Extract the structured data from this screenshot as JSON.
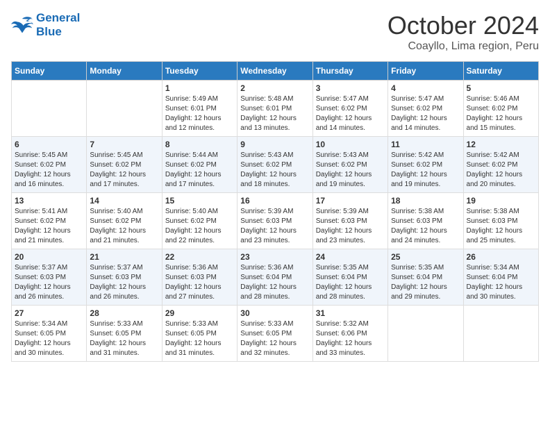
{
  "logo": {
    "line1": "General",
    "line2": "Blue"
  },
  "title": "October 2024",
  "location": "Coayllo, Lima region, Peru",
  "weekdays": [
    "Sunday",
    "Monday",
    "Tuesday",
    "Wednesday",
    "Thursday",
    "Friday",
    "Saturday"
  ],
  "weeks": [
    [
      {
        "day": "",
        "sunrise": "",
        "sunset": "",
        "daylight": ""
      },
      {
        "day": "",
        "sunrise": "",
        "sunset": "",
        "daylight": ""
      },
      {
        "day": "1",
        "sunrise": "Sunrise: 5:49 AM",
        "sunset": "Sunset: 6:01 PM",
        "daylight": "Daylight: 12 hours and 12 minutes."
      },
      {
        "day": "2",
        "sunrise": "Sunrise: 5:48 AM",
        "sunset": "Sunset: 6:01 PM",
        "daylight": "Daylight: 12 hours and 13 minutes."
      },
      {
        "day": "3",
        "sunrise": "Sunrise: 5:47 AM",
        "sunset": "Sunset: 6:02 PM",
        "daylight": "Daylight: 12 hours and 14 minutes."
      },
      {
        "day": "4",
        "sunrise": "Sunrise: 5:47 AM",
        "sunset": "Sunset: 6:02 PM",
        "daylight": "Daylight: 12 hours and 14 minutes."
      },
      {
        "day": "5",
        "sunrise": "Sunrise: 5:46 AM",
        "sunset": "Sunset: 6:02 PM",
        "daylight": "Daylight: 12 hours and 15 minutes."
      }
    ],
    [
      {
        "day": "6",
        "sunrise": "Sunrise: 5:45 AM",
        "sunset": "Sunset: 6:02 PM",
        "daylight": "Daylight: 12 hours and 16 minutes."
      },
      {
        "day": "7",
        "sunrise": "Sunrise: 5:45 AM",
        "sunset": "Sunset: 6:02 PM",
        "daylight": "Daylight: 12 hours and 17 minutes."
      },
      {
        "day": "8",
        "sunrise": "Sunrise: 5:44 AM",
        "sunset": "Sunset: 6:02 PM",
        "daylight": "Daylight: 12 hours and 17 minutes."
      },
      {
        "day": "9",
        "sunrise": "Sunrise: 5:43 AM",
        "sunset": "Sunset: 6:02 PM",
        "daylight": "Daylight: 12 hours and 18 minutes."
      },
      {
        "day": "10",
        "sunrise": "Sunrise: 5:43 AM",
        "sunset": "Sunset: 6:02 PM",
        "daylight": "Daylight: 12 hours and 19 minutes."
      },
      {
        "day": "11",
        "sunrise": "Sunrise: 5:42 AM",
        "sunset": "Sunset: 6:02 PM",
        "daylight": "Daylight: 12 hours and 19 minutes."
      },
      {
        "day": "12",
        "sunrise": "Sunrise: 5:42 AM",
        "sunset": "Sunset: 6:02 PM",
        "daylight": "Daylight: 12 hours and 20 minutes."
      }
    ],
    [
      {
        "day": "13",
        "sunrise": "Sunrise: 5:41 AM",
        "sunset": "Sunset: 6:02 PM",
        "daylight": "Daylight: 12 hours and 21 minutes."
      },
      {
        "day": "14",
        "sunrise": "Sunrise: 5:40 AM",
        "sunset": "Sunset: 6:02 PM",
        "daylight": "Daylight: 12 hours and 21 minutes."
      },
      {
        "day": "15",
        "sunrise": "Sunrise: 5:40 AM",
        "sunset": "Sunset: 6:02 PM",
        "daylight": "Daylight: 12 hours and 22 minutes."
      },
      {
        "day": "16",
        "sunrise": "Sunrise: 5:39 AM",
        "sunset": "Sunset: 6:03 PM",
        "daylight": "Daylight: 12 hours and 23 minutes."
      },
      {
        "day": "17",
        "sunrise": "Sunrise: 5:39 AM",
        "sunset": "Sunset: 6:03 PM",
        "daylight": "Daylight: 12 hours and 23 minutes."
      },
      {
        "day": "18",
        "sunrise": "Sunrise: 5:38 AM",
        "sunset": "Sunset: 6:03 PM",
        "daylight": "Daylight: 12 hours and 24 minutes."
      },
      {
        "day": "19",
        "sunrise": "Sunrise: 5:38 AM",
        "sunset": "Sunset: 6:03 PM",
        "daylight": "Daylight: 12 hours and 25 minutes."
      }
    ],
    [
      {
        "day": "20",
        "sunrise": "Sunrise: 5:37 AM",
        "sunset": "Sunset: 6:03 PM",
        "daylight": "Daylight: 12 hours and 26 minutes."
      },
      {
        "day": "21",
        "sunrise": "Sunrise: 5:37 AM",
        "sunset": "Sunset: 6:03 PM",
        "daylight": "Daylight: 12 hours and 26 minutes."
      },
      {
        "day": "22",
        "sunrise": "Sunrise: 5:36 AM",
        "sunset": "Sunset: 6:03 PM",
        "daylight": "Daylight: 12 hours and 27 minutes."
      },
      {
        "day": "23",
        "sunrise": "Sunrise: 5:36 AM",
        "sunset": "Sunset: 6:04 PM",
        "daylight": "Daylight: 12 hours and 28 minutes."
      },
      {
        "day": "24",
        "sunrise": "Sunrise: 5:35 AM",
        "sunset": "Sunset: 6:04 PM",
        "daylight": "Daylight: 12 hours and 28 minutes."
      },
      {
        "day": "25",
        "sunrise": "Sunrise: 5:35 AM",
        "sunset": "Sunset: 6:04 PM",
        "daylight": "Daylight: 12 hours and 29 minutes."
      },
      {
        "day": "26",
        "sunrise": "Sunrise: 5:34 AM",
        "sunset": "Sunset: 6:04 PM",
        "daylight": "Daylight: 12 hours and 30 minutes."
      }
    ],
    [
      {
        "day": "27",
        "sunrise": "Sunrise: 5:34 AM",
        "sunset": "Sunset: 6:05 PM",
        "daylight": "Daylight: 12 hours and 30 minutes."
      },
      {
        "day": "28",
        "sunrise": "Sunrise: 5:33 AM",
        "sunset": "Sunset: 6:05 PM",
        "daylight": "Daylight: 12 hours and 31 minutes."
      },
      {
        "day": "29",
        "sunrise": "Sunrise: 5:33 AM",
        "sunset": "Sunset: 6:05 PM",
        "daylight": "Daylight: 12 hours and 31 minutes."
      },
      {
        "day": "30",
        "sunrise": "Sunrise: 5:33 AM",
        "sunset": "Sunset: 6:05 PM",
        "daylight": "Daylight: 12 hours and 32 minutes."
      },
      {
        "day": "31",
        "sunrise": "Sunrise: 5:32 AM",
        "sunset": "Sunset: 6:06 PM",
        "daylight": "Daylight: 12 hours and 33 minutes."
      },
      {
        "day": "",
        "sunrise": "",
        "sunset": "",
        "daylight": ""
      },
      {
        "day": "",
        "sunrise": "",
        "sunset": "",
        "daylight": ""
      }
    ]
  ]
}
